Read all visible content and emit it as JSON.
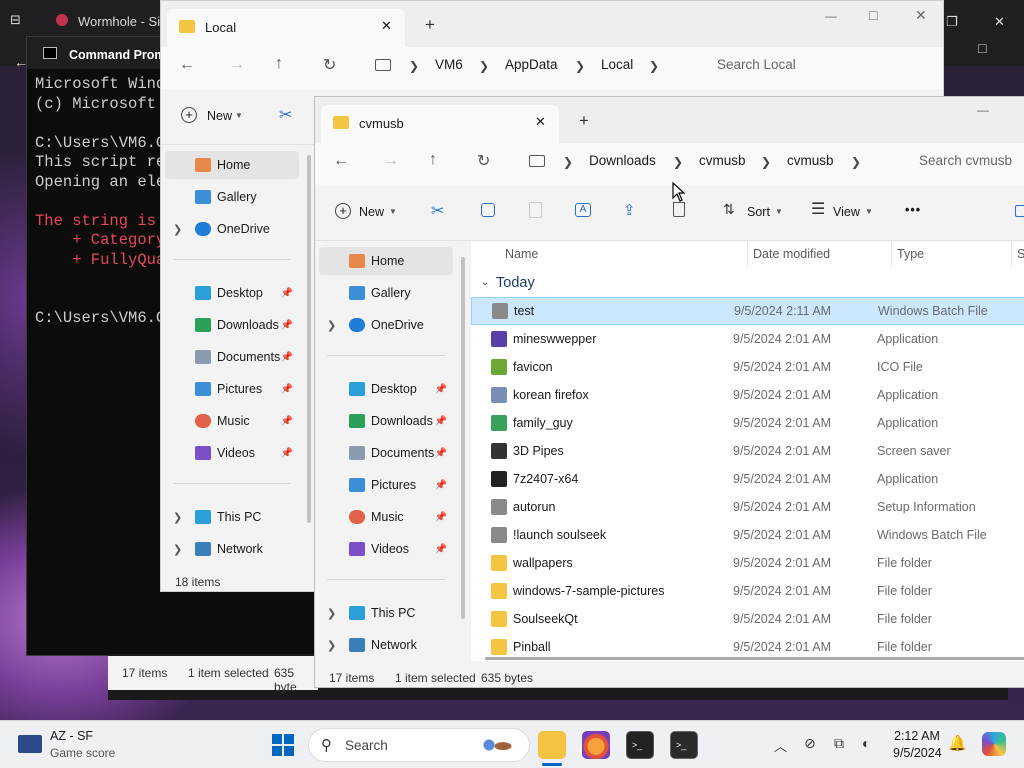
{
  "background_window": {
    "tab_title": "Wormhole - Sin",
    "controls": {
      "min": "—",
      "max": "□",
      "close": "✕"
    }
  },
  "cmd": {
    "title": "Command Prom",
    "lines": [
      "Microsoft Wind",
      "(c) Microsoft",
      "",
      "C:\\Users\\VM6.C",
      "This script re",
      "Opening an ele",
      ""
    ],
    "red_lines": [
      "The string is",
      "    + Category",
      "    + FullyQua"
    ],
    "prompt": "C:\\Users\\VM6.C"
  },
  "local": {
    "tab_title": "Local",
    "breadcrumb": [
      "VM6",
      "AppData",
      "Local"
    ],
    "search_placeholder": "Search Local",
    "new_label": "New",
    "nav": {
      "home": "Home",
      "gallery": "Gallery",
      "onedrive": "OneDrive",
      "quick": [
        "Desktop",
        "Downloads",
        "Documents",
        "Pictures",
        "Music",
        "Videos"
      ],
      "thispc": "This PC",
      "network": "Network"
    },
    "status": "18 items"
  },
  "cvmusb": {
    "tab_title": "cvmusb",
    "breadcrumb": [
      "Downloads",
      "cvmusb",
      "cvmusb"
    ],
    "search_placeholder": "Search cvmusb",
    "toolbar": {
      "new": "New",
      "sort": "Sort",
      "view": "View",
      "more": "•••"
    },
    "nav": {
      "home": "Home",
      "gallery": "Gallery",
      "onedrive": "OneDrive",
      "quick": [
        "Desktop",
        "Downloads",
        "Documents",
        "Pictures",
        "Music",
        "Videos"
      ],
      "thispc": "This PC",
      "network": "Network"
    },
    "columns": {
      "name": "Name",
      "date": "Date modified",
      "type": "Type",
      "size": "Si"
    },
    "group": "Today",
    "files": [
      {
        "name": "test",
        "date": "9/5/2024 2:11 AM",
        "type": "Windows Batch File",
        "icon": "batch-icon",
        "color": "#8a8a8a"
      },
      {
        "name": "mineswwepper",
        "date": "9/5/2024 2:01 AM",
        "type": "Application",
        "icon": "app-icon",
        "color": "#5b3fa8"
      },
      {
        "name": "favicon",
        "date": "9/5/2024 2:01 AM",
        "type": "ICO File",
        "icon": "ico-icon",
        "color": "#6da832"
      },
      {
        "name": "korean firefox",
        "date": "9/5/2024 2:01 AM",
        "type": "Application",
        "icon": "app-icon",
        "color": "#7a8fb8"
      },
      {
        "name": "family_guy",
        "date": "9/5/2024 2:01 AM",
        "type": "Application",
        "icon": "app-icon",
        "color": "#3aa05a"
      },
      {
        "name": "3D Pipes",
        "date": "9/5/2024 2:01 AM",
        "type": "Screen saver",
        "icon": "screensaver-icon",
        "color": "#333333"
      },
      {
        "name": "7z2407-x64",
        "date": "9/5/2024 2:01 AM",
        "type": "Application",
        "icon": "7zip-icon",
        "color": "#222222"
      },
      {
        "name": "autorun",
        "date": "9/5/2024 2:01 AM",
        "type": "Setup Information",
        "icon": "inf-icon",
        "color": "#8a8a8a"
      },
      {
        "name": "!launch soulseek",
        "date": "9/5/2024 2:01 AM",
        "type": "Windows Batch File",
        "icon": "batch-icon",
        "color": "#8a8a8a"
      },
      {
        "name": "wallpapers",
        "date": "9/5/2024 2:01 AM",
        "type": "File folder",
        "icon": "folder-icon",
        "color": "#f4c542"
      },
      {
        "name": "windows-7-sample-pictures",
        "date": "9/5/2024 2:01 AM",
        "type": "File folder",
        "icon": "folder-icon",
        "color": "#f4c542"
      },
      {
        "name": "SoulseekQt",
        "date": "9/5/2024 2:01 AM",
        "type": "File folder",
        "icon": "folder-icon",
        "color": "#f4c542"
      },
      {
        "name": "Pinball",
        "date": "9/5/2024 2:01 AM",
        "type": "File folder",
        "icon": "folder-icon",
        "color": "#f4c542"
      }
    ],
    "status": {
      "count": "17 items",
      "selected": "1 item selected",
      "size": "635 bytes"
    }
  },
  "behind_status": {
    "count": "17 items",
    "selected": "1 item selected",
    "size": "635 byte"
  },
  "taskbar": {
    "weather_title": "AZ - SF",
    "weather_sub": "Game score",
    "search": "Search",
    "time": "2:12 AM",
    "date": "9/5/2024",
    "accent": "#0067c0"
  }
}
